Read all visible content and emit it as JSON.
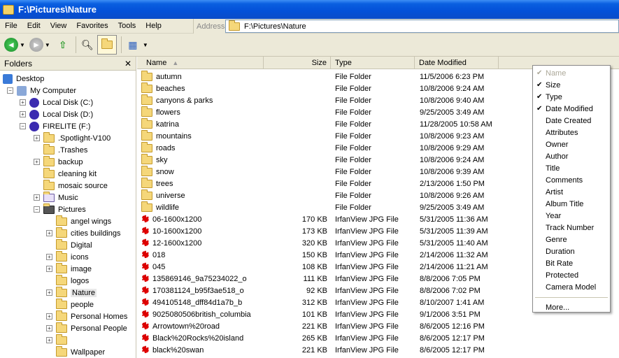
{
  "window": {
    "title": "F:\\Pictures\\Nature"
  },
  "menu": [
    "File",
    "Edit",
    "View",
    "Favorites",
    "Tools",
    "Help"
  ],
  "address": {
    "label": "Address",
    "value": "F:\\Pictures\\Nature"
  },
  "folders_panel": {
    "title": "Folders",
    "close": "✕",
    "tree": [
      {
        "label": "Desktop",
        "icon": "desktop-icon",
        "level": 0,
        "expander": ""
      },
      {
        "label": "My Computer",
        "icon": "computer-icon",
        "level": 1,
        "expander": "−"
      },
      {
        "label": "Local Disk (C:)",
        "icon": "drive-icon",
        "level": 2,
        "expander": "+"
      },
      {
        "label": "Local Disk (D:)",
        "icon": "drive-icon",
        "level": 2,
        "expander": "+"
      },
      {
        "label": "FIRELITE (F:)",
        "icon": "drive-icon",
        "level": 2,
        "expander": "−"
      },
      {
        "label": ".Spotlight-V100",
        "icon": "folder-icon",
        "level": 3,
        "expander": "+"
      },
      {
        "label": ".Trashes",
        "icon": "folder-icon",
        "level": 3,
        "expander": ""
      },
      {
        "label": "backup",
        "icon": "folder-icon",
        "level": 3,
        "expander": "+"
      },
      {
        "label": "cleaning kit",
        "icon": "folder-icon",
        "level": 3,
        "expander": ""
      },
      {
        "label": "mosaic source",
        "icon": "folder-icon",
        "level": 3,
        "expander": ""
      },
      {
        "label": "Music",
        "icon": "music-folder-icon",
        "level": 3,
        "expander": "+"
      },
      {
        "label": "Pictures",
        "icon": "pictures-folder-icon",
        "level": 3,
        "expander": "−"
      },
      {
        "label": "angel wings",
        "icon": "folder-icon",
        "level": 4,
        "expander": ""
      },
      {
        "label": "cities buildings",
        "icon": "folder-icon",
        "level": 4,
        "expander": "+"
      },
      {
        "label": "Digital",
        "icon": "folder-icon",
        "level": 4,
        "expander": ""
      },
      {
        "label": "icons",
        "icon": "folder-icon",
        "level": 4,
        "expander": "+"
      },
      {
        "label": "image",
        "icon": "folder-icon",
        "level": 4,
        "expander": "+"
      },
      {
        "label": "logos",
        "icon": "folder-icon",
        "level": 4,
        "expander": ""
      },
      {
        "label": "Nature",
        "icon": "folder-icon",
        "level": 4,
        "expander": "+",
        "selected": true
      },
      {
        "label": "people",
        "icon": "folder-icon",
        "level": 4,
        "expander": ""
      },
      {
        "label": "Personal Homes",
        "icon": "folder-icon",
        "level": 4,
        "expander": "+"
      },
      {
        "label": "Personal People",
        "icon": "folder-icon",
        "level": 4,
        "expander": "+"
      },
      {
        "label": "",
        "icon": "folder-icon",
        "level": 4,
        "expander": "+"
      },
      {
        "label": "Wallpaper",
        "icon": "folder-icon",
        "level": 4,
        "expander": ""
      }
    ]
  },
  "columns": {
    "name": "Name",
    "size": "Size",
    "type": "Type",
    "date": "Date Modified"
  },
  "files": [
    {
      "name": "autumn",
      "size": "",
      "type": "File Folder",
      "date": "11/5/2006 6:23 PM",
      "icon": "folder-icon"
    },
    {
      "name": "beaches",
      "size": "",
      "type": "File Folder",
      "date": "10/8/2006 9:24 AM",
      "icon": "folder-icon"
    },
    {
      "name": "canyons & parks",
      "size": "",
      "type": "File Folder",
      "date": "10/8/2006 9:40 AM",
      "icon": "folder-icon"
    },
    {
      "name": "flowers",
      "size": "",
      "type": "File Folder",
      "date": "9/25/2005 3:49 AM",
      "icon": "folder-icon"
    },
    {
      "name": "katrina",
      "size": "",
      "type": "File Folder",
      "date": "11/28/2005 10:58 AM",
      "icon": "folder-icon"
    },
    {
      "name": "mountains",
      "size": "",
      "type": "File Folder",
      "date": "10/8/2006 9:23 AM",
      "icon": "folder-icon"
    },
    {
      "name": "roads",
      "size": "",
      "type": "File Folder",
      "date": "10/8/2006 9:29 AM",
      "icon": "folder-icon"
    },
    {
      "name": "sky",
      "size": "",
      "type": "File Folder",
      "date": "10/8/2006 9:24 AM",
      "icon": "folder-icon"
    },
    {
      "name": "snow",
      "size": "",
      "type": "File Folder",
      "date": "10/8/2006 9:39 AM",
      "icon": "folder-icon"
    },
    {
      "name": "trees",
      "size": "",
      "type": "File Folder",
      "date": "2/13/2006 1:50 PM",
      "icon": "folder-icon"
    },
    {
      "name": "universe",
      "size": "",
      "type": "File Folder",
      "date": "10/8/2006 9:26 AM",
      "icon": "folder-icon"
    },
    {
      "name": "wildlife",
      "size": "",
      "type": "File Folder",
      "date": "9/25/2005 3:49 AM",
      "icon": "folder-icon"
    },
    {
      "name": "06-1600x1200",
      "size": "170 KB",
      "type": "IrfanView JPG File",
      "date": "5/31/2005 11:36 AM",
      "icon": "irfanview-jpg-icon"
    },
    {
      "name": "10-1600x1200",
      "size": "173 KB",
      "type": "IrfanView JPG File",
      "date": "5/31/2005 11:39 AM",
      "icon": "irfanview-jpg-icon"
    },
    {
      "name": "12-1600x1200",
      "size": "320 KB",
      "type": "IrfanView JPG File",
      "date": "5/31/2005 11:40 AM",
      "icon": "irfanview-jpg-icon"
    },
    {
      "name": "018",
      "size": "150 KB",
      "type": "IrfanView JPG File",
      "date": "2/14/2006 11:32 AM",
      "icon": "irfanview-jpg-icon"
    },
    {
      "name": "045",
      "size": "108 KB",
      "type": "IrfanView JPG File",
      "date": "2/14/2006 11:21 AM",
      "icon": "irfanview-jpg-icon"
    },
    {
      "name": "135869146_9a75234022_o",
      "size": "111 KB",
      "type": "IrfanView JPG File",
      "date": "8/8/2006 7:05 PM",
      "icon": "irfanview-jpg-icon"
    },
    {
      "name": "170381124_b95f3ae518_o",
      "size": "92 KB",
      "type": "IrfanView JPG File",
      "date": "8/8/2006 7:02 PM",
      "icon": "irfanview-jpg-icon"
    },
    {
      "name": "494105148_dff84d1a7b_b",
      "size": "312 KB",
      "type": "IrfanView JPG File",
      "date": "8/10/2007 1:41 AM",
      "icon": "irfanview-jpg-icon"
    },
    {
      "name": "9025080506british_columbia",
      "size": "101 KB",
      "type": "IrfanView JPG File",
      "date": "9/1/2006 3:51 PM",
      "icon": "irfanview-jpg-icon"
    },
    {
      "name": "Arrowtown%20road",
      "size": "221 KB",
      "type": "IrfanView JPG File",
      "date": "8/6/2005 12:16 PM",
      "icon": "irfanview-jpg-icon"
    },
    {
      "name": "Black%20Rocks%20island",
      "size": "265 KB",
      "type": "IrfanView JPG File",
      "date": "8/6/2005 12:17 PM",
      "icon": "irfanview-jpg-icon"
    },
    {
      "name": "black%20swan",
      "size": "221 KB",
      "type": "IrfanView JPG File",
      "date": "8/6/2005 12:17 PM",
      "icon": "irfanview-jpg-icon"
    }
  ],
  "context_menu": {
    "items": [
      {
        "label": "Name",
        "checked": true,
        "disabled": true
      },
      {
        "label": "Size",
        "checked": true
      },
      {
        "label": "Type",
        "checked": true
      },
      {
        "label": "Date Modified",
        "checked": true
      },
      {
        "label": "Date Created"
      },
      {
        "label": "Attributes"
      },
      {
        "label": "Owner"
      },
      {
        "label": "Author"
      },
      {
        "label": "Title"
      },
      {
        "label": "Comments"
      },
      {
        "label": "Artist"
      },
      {
        "label": "Album Title"
      },
      {
        "label": "Year"
      },
      {
        "label": "Track Number"
      },
      {
        "label": "Genre"
      },
      {
        "label": "Duration"
      },
      {
        "label": "Bit Rate"
      },
      {
        "label": "Protected"
      },
      {
        "label": "Camera Model"
      }
    ],
    "more": "More..."
  }
}
